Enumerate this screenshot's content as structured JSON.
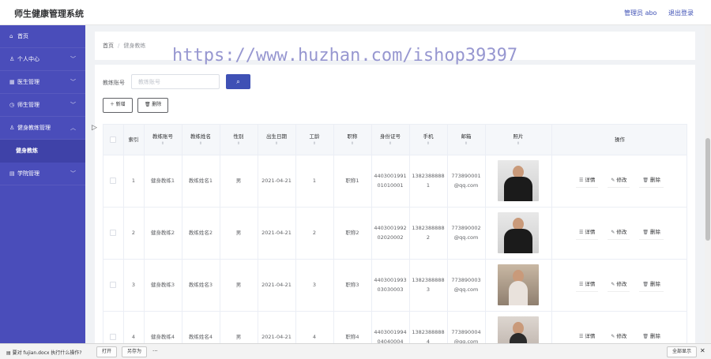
{
  "header": {
    "title": "师生健康管理系统",
    "user": "管理员 abo",
    "logout": "退出登录"
  },
  "sidebar": {
    "items": [
      {
        "icon": "home-icon",
        "glyph": "⌂",
        "label": "首页",
        "has_chevron": false
      },
      {
        "icon": "person-icon",
        "glyph": "♙",
        "label": "个人中心",
        "has_chevron": true
      },
      {
        "icon": "grid-icon",
        "glyph": "▦",
        "label": "医生管理",
        "has_chevron": true
      },
      {
        "icon": "clock-icon",
        "glyph": "◷",
        "label": "师生管理",
        "has_chevron": true
      },
      {
        "icon": "person-icon",
        "glyph": "♙",
        "label": "健身教练管理",
        "has_chevron": true,
        "expanded": true
      },
      {
        "icon": "grid-icon",
        "glyph": "▤",
        "label": "学院管理",
        "has_chevron": true
      }
    ],
    "sub_item": "健身教练"
  },
  "breadcrumb": {
    "home": "首页",
    "separator": "/",
    "current": "健身教练"
  },
  "search": {
    "label": "教练账号",
    "placeholder": "教练账号"
  },
  "toolbar": {
    "add_label": "＋ 新增",
    "delete_label": "🗑 删除"
  },
  "table": {
    "headers": [
      "",
      "索引",
      "教练账号",
      "教练姓名",
      "性别",
      "出生日期",
      "工龄",
      "职称",
      "身份证号",
      "手机",
      "邮箱",
      "照片",
      "操作"
    ],
    "sortable": [
      false,
      false,
      true,
      true,
      true,
      true,
      true,
      true,
      true,
      true,
      true,
      true,
      false
    ],
    "rows": [
      {
        "index": "1",
        "account": "健身教练1",
        "name": "教练姓名1",
        "gender": "男",
        "birth": "2021-04-21",
        "years": "1",
        "title": "职称1",
        "id_card": "440300199101010001",
        "phone": "13823888881",
        "email": "773890001@qq.com",
        "photo": "man"
      },
      {
        "index": "2",
        "account": "健身教练2",
        "name": "教练姓名2",
        "gender": "男",
        "birth": "2021-04-21",
        "years": "2",
        "title": "职称2",
        "id_card": "440300199202020002",
        "phone": "13823888882",
        "email": "773890002@qq.com",
        "photo": "man"
      },
      {
        "index": "3",
        "account": "健身教练3",
        "name": "教练姓名3",
        "gender": "男",
        "birth": "2021-04-21",
        "years": "3",
        "title": "职称3",
        "id_card": "440300199303030003",
        "phone": "13823888883",
        "email": "773890003@qq.com",
        "photo": "woman-light"
      },
      {
        "index": "4",
        "account": "健身教练4",
        "name": "教练姓名4",
        "gender": "男",
        "birth": "2021-04-21",
        "years": "4",
        "title": "职称4",
        "id_card": "440300199404040004",
        "phone": "13823888884",
        "email": "773890004@qq.com",
        "photo": "woman-dark"
      }
    ],
    "actions": [
      {
        "icon": "detail-icon",
        "glyph": "☰",
        "label": "详情"
      },
      {
        "icon": "edit-icon",
        "glyph": "✎",
        "label": "修改"
      },
      {
        "icon": "trash-icon",
        "glyph": "🗑",
        "label": "删除"
      }
    ]
  },
  "download_bar": {
    "message": "要对 fujian.docx 执行什么操作?",
    "open": "打开",
    "save_as": "另存为",
    "more": "···",
    "show_all": "全部显示",
    "close": "✕"
  },
  "watermark": "https://www.huzhan.com/ishop39397",
  "colors": {
    "sidebar": "#4a4dba",
    "accent": "#3f51b5"
  }
}
